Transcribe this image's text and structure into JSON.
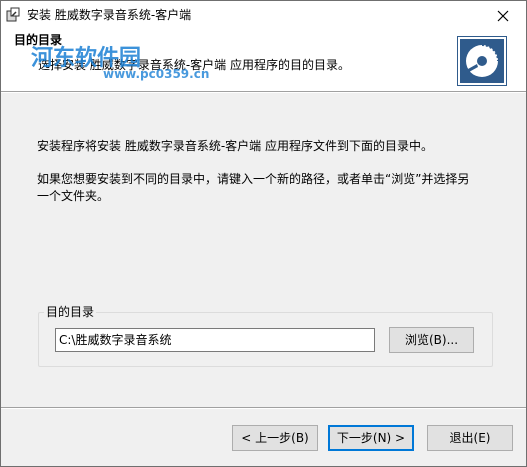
{
  "window": {
    "title": "安装 胜威数字录音系统-客户端"
  },
  "header": {
    "title": "目的目录",
    "subtitle": "选择安装 胜威数字录音系统-客户端 应用程序的目的目录。",
    "watermark_text": "河东软件园",
    "watermark_url": "www.pc0359.cn"
  },
  "body": {
    "paragraph1": "安装程序将安装 胜威数字录音系统-客户端 应用程序文件到下面的目录中。",
    "paragraph2": "如果您想要安装到不同的目录中，请键入一个新的路径，或者单击“浏览”并选择另一个文件夹。"
  },
  "destination": {
    "group_label": "目的目录",
    "path_value": "C:\\胜威数字录音系统",
    "browse_label": "浏览(B)..."
  },
  "footer": {
    "back_label": "< 上一步(B)",
    "next_label": "下一步(N) >",
    "exit_label": "退出(E)"
  },
  "icons": {
    "app": "installer-icon",
    "logo": "installer-disc-logo",
    "close": "close-icon"
  },
  "colors": {
    "dialog_bg": "#f0f0f0",
    "header_bg": "#ffffff",
    "logo_bg": "#2f5b8c",
    "watermark": "#1a7fd4",
    "default_button_border": "#0078d7"
  }
}
